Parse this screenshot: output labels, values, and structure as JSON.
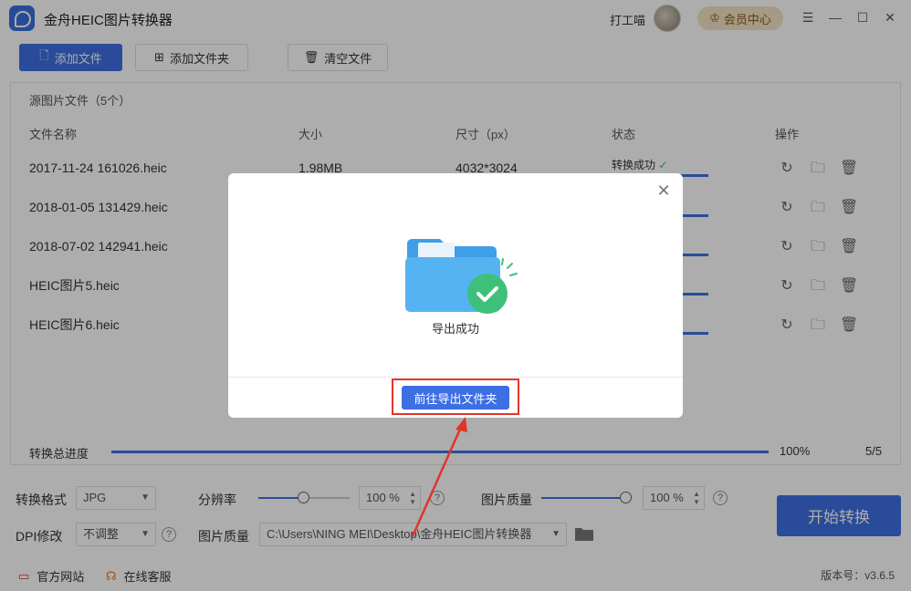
{
  "app": {
    "title": "金舟HEIC图片转换器",
    "username": "打工喵",
    "member_label": "会员中心"
  },
  "toolbar": {
    "add_file": "添加文件",
    "add_folder": "添加文件夹",
    "clear": "清空文件"
  },
  "panel": {
    "title": "源图片文件（5个）",
    "columns": [
      "文件名称",
      "大小",
      "尺寸（px）",
      "状态",
      "操作"
    ],
    "rows": [
      {
        "name": "2017-11-24 161026.heic",
        "size": "1.98MB",
        "dims": "4032*3024",
        "status": "转换成功"
      },
      {
        "name": "2018-01-05 131429.heic"
      },
      {
        "name": "2018-07-02 142941.heic"
      },
      {
        "name": "HEIC图片5.heic"
      },
      {
        "name": "HEIC图片6.heic"
      }
    ],
    "progress_label": "转换总进度",
    "progress_pct": "100%",
    "progress_count": "5/5"
  },
  "settings": {
    "format_label": "转换格式",
    "format_value": "JPG",
    "resolution_label": "分辨率",
    "resolution_value": "100 %",
    "resolution_level": 0.5,
    "quality_label": "图片质量",
    "quality_value": "100 %",
    "quality_level": 1.0,
    "dpi_label": "DPI修改",
    "dpi_value": "不调整",
    "output_label": "图片质量",
    "output_path": "C:\\Users\\NING MEI\\Desktop\\金舟HEIC图片转换器",
    "start_label": "开始转换"
  },
  "footer": {
    "website": "官方网站",
    "support": "在线客服",
    "version": "版本号：v3.6.5"
  },
  "dialog": {
    "message": "导出成功",
    "goto_button": "前往导出文件夹"
  },
  "colors": {
    "accent": "#3d6fe3",
    "success": "#3ec07a",
    "annotation": "#e0352b"
  }
}
